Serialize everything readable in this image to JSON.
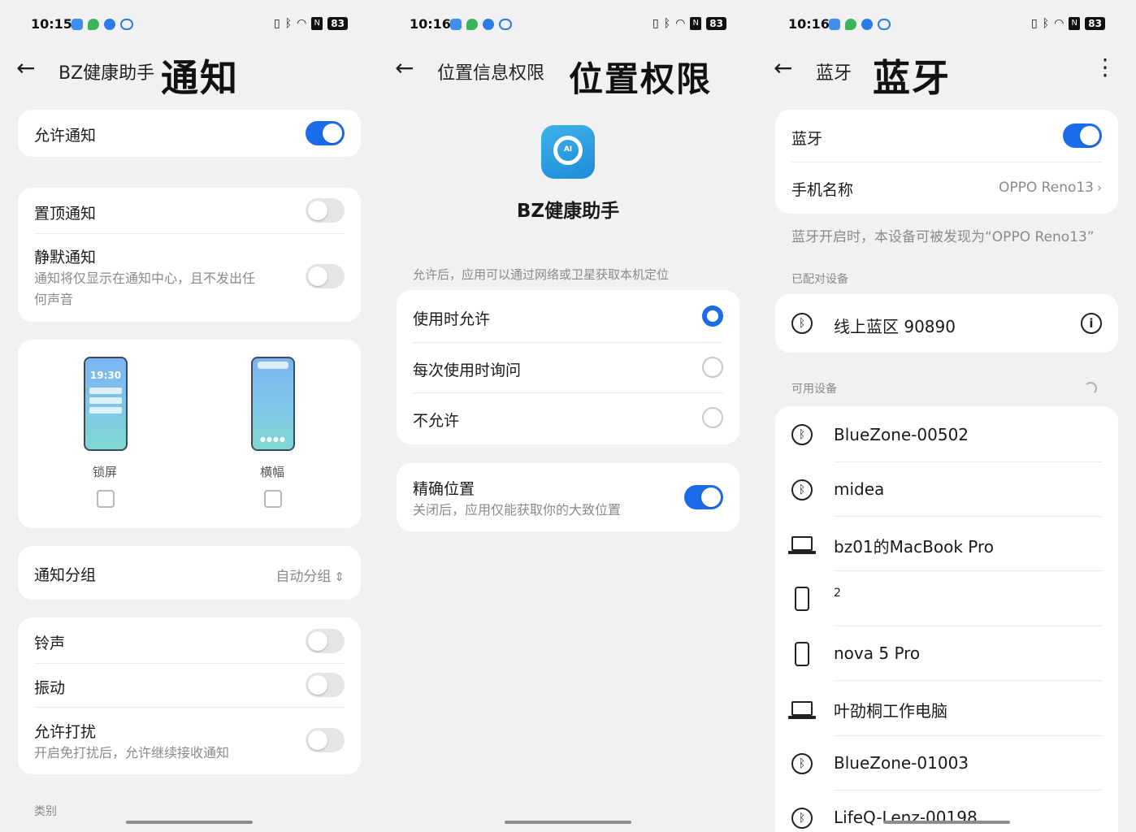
{
  "screen1": {
    "status": {
      "time": "10:15",
      "battery": "83"
    },
    "header": {
      "title": "BZ健康助手",
      "big_title": "通知"
    },
    "allow_notifications": {
      "label": "允许通知",
      "on": true
    },
    "pin": {
      "label": "置顶通知",
      "on": false
    },
    "silent": {
      "label": "静默通知",
      "desc_line1": "通知将仅显示在通知中心，且不发出任",
      "desc_line2": "何声音",
      "on": false
    },
    "styles": {
      "lock_time": "19:30",
      "lock_label": "锁屏",
      "banner_label": "横幅"
    },
    "grouping": {
      "label": "通知分组",
      "value": "自动分组"
    },
    "ringtone": {
      "label": "铃声",
      "on": false
    },
    "vibrate": {
      "label": "振动",
      "on": false
    },
    "dnd": {
      "label": "允许打扰",
      "desc": "开启免打扰后，允许继续接收通知",
      "on": false
    },
    "category_label": "类别"
  },
  "screen2": {
    "status": {
      "time": "10:16",
      "battery": "83"
    },
    "header": {
      "title": "位置信息权限",
      "big_title": "位置权限"
    },
    "app": {
      "name": "BZ健康助手",
      "icon_text": "AI"
    },
    "section_label": "允许后，应用可以通过网络或卫星获取本机定位",
    "options": [
      {
        "label": "使用时允许",
        "selected": true
      },
      {
        "label": "每次使用时询问",
        "selected": false
      },
      {
        "label": "不允许",
        "selected": false
      }
    ],
    "precise": {
      "label": "精确位置",
      "desc": "关闭后，应用仅能获取你的大致位置",
      "on": true
    }
  },
  "screen3": {
    "status": {
      "time": "10:16",
      "battery": "83"
    },
    "header": {
      "title": "蓝牙",
      "big_title": "蓝牙"
    },
    "bluetooth": {
      "label": "蓝牙",
      "on": true
    },
    "phone_name": {
      "label": "手机名称",
      "value": "OPPO Reno13"
    },
    "visible_hint": "蓝牙开启时，本设备可被发现为“OPPO Reno13”",
    "paired_label": "已配对设备",
    "paired": [
      {
        "name": "线上蓝区 90890",
        "icon": "bluetooth-icon"
      }
    ],
    "available_label": "可用设备",
    "available": [
      {
        "name": "BlueZone-00502",
        "icon": "bluetooth-icon"
      },
      {
        "name": "midea",
        "icon": "bluetooth-icon"
      },
      {
        "name": "bz01的MacBook Pro",
        "icon": "laptop-icon"
      },
      {
        "name": "2",
        "icon": "phone-icon"
      },
      {
        "name": "nova 5 Pro",
        "icon": "phone-icon"
      },
      {
        "name": "叶劭桐工作电脑",
        "icon": "laptop-icon"
      },
      {
        "name": "BlueZone-01003",
        "icon": "bluetooth-icon"
      },
      {
        "name": "LifeQ-Lenz-00198",
        "icon": "bluetooth-icon"
      }
    ]
  },
  "colors": {
    "accent": "#1a6ce8",
    "background": "#f1f1f3",
    "card": "#ffffff"
  }
}
